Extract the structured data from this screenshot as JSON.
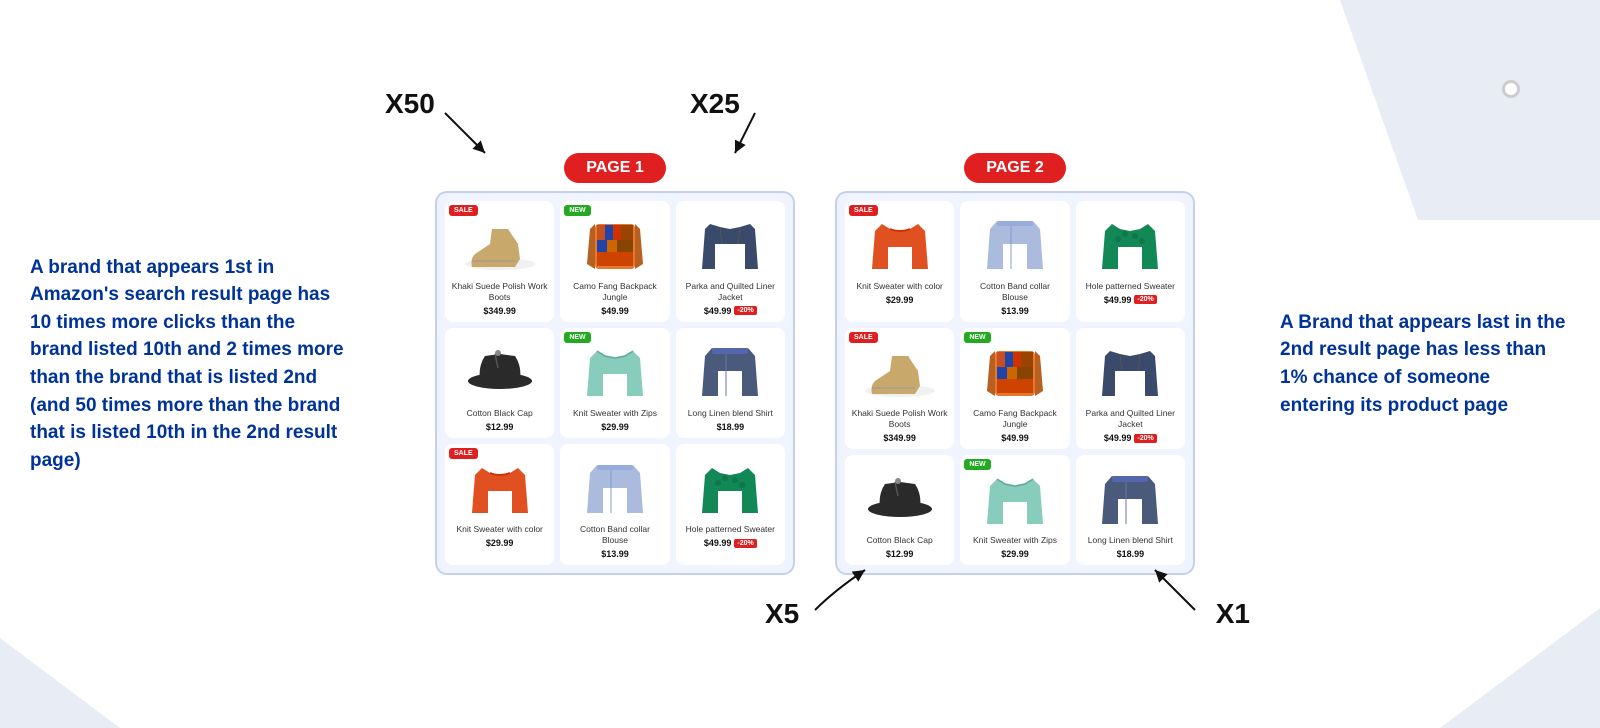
{
  "background": {
    "colors": {
      "accent_blue": "#003399",
      "sale_red": "#e02020",
      "new_green": "#22aa22",
      "page_bg": "#f0f4ff",
      "page_border": "#c5d0f0"
    }
  },
  "left_text": "A brand that appears 1st in Amazon's search result page has 10 times more clicks than the brand listed 10th and 2 times more than the brand that is listed 2nd (and 50 times more than the brand that is listed 10th in the 2nd result page)",
  "right_text": "A Brand that appears last in the 2nd result page has less than 1% chance of someone entering its product page",
  "multipliers": {
    "x50": "X50",
    "x25": "X25",
    "x5": "X5",
    "x1": "X1"
  },
  "pages": [
    {
      "id": "page1",
      "label": "PAGE 1",
      "products": [
        {
          "name": "Khaki Suede Polish Work Boots",
          "price": "$349.99",
          "badge": "SALE",
          "badge_type": "sale",
          "color": "#c8a86b",
          "type": "boot"
        },
        {
          "name": "Camo Fang Backpack Jungle",
          "price": "$49.99",
          "badge": "NEW",
          "badge_type": "new",
          "color": "#e67830",
          "type": "jacket_camo"
        },
        {
          "name": "Parka and Quilted Liner Jacket",
          "price": "$49.99",
          "badge": "",
          "badge_type": "",
          "discount": "-20%",
          "color": "#3a4a6b",
          "type": "parka"
        },
        {
          "name": "Cotton Black Cap",
          "price": "$12.99",
          "badge": "",
          "badge_type": "",
          "color": "#2a2a2a",
          "type": "hat"
        },
        {
          "name": "Knit Sweater with Zips",
          "price": "$29.99",
          "badge": "NEW",
          "badge_type": "new",
          "color": "#88ccbb",
          "type": "knit"
        },
        {
          "name": "Long Linen blend Shirt",
          "price": "$18.99",
          "badge": "",
          "badge_type": "",
          "color": "#4a5a7a",
          "type": "linen"
        },
        {
          "name": "Knit Sweater with color",
          "price": "$29.99",
          "badge": "SALE",
          "badge_type": "sale",
          "color": "#e05020",
          "type": "sweater_orange"
        },
        {
          "name": "Cotton Band collar Blouse",
          "price": "$13.99",
          "badge": "",
          "badge_type": "",
          "color": "#aabbdd",
          "type": "blouse"
        },
        {
          "name": "Hole patterned Sweater",
          "price": "$49.99",
          "badge": "",
          "badge_type": "",
          "discount": "-20%",
          "color": "#118855",
          "type": "sweater_green"
        }
      ]
    },
    {
      "id": "page2",
      "label": "PAGE 2",
      "products": [
        {
          "name": "Knit Sweater with color",
          "price": "$29.99",
          "badge": "SALE",
          "badge_type": "sale",
          "color": "#e05020",
          "type": "sweater_orange"
        },
        {
          "name": "Cotton Band collar Blouse",
          "price": "$13.99",
          "badge": "",
          "badge_type": "",
          "color": "#aabbdd",
          "type": "blouse"
        },
        {
          "name": "Hole patterned Sweater",
          "price": "$49.99",
          "badge": "",
          "badge_type": "",
          "discount": "-20%",
          "color": "#118855",
          "type": "sweater_green"
        },
        {
          "name": "Khaki Suede Polish Work Boots",
          "price": "$349.99",
          "badge": "SALE",
          "badge_type": "sale",
          "color": "#c8a86b",
          "type": "boot"
        },
        {
          "name": "Camo Fang Backpack Jungle",
          "price": "$49.99",
          "badge": "NEW",
          "badge_type": "new",
          "color": "#e67830",
          "type": "jacket_camo"
        },
        {
          "name": "Parka and Quilted Liner Jacket",
          "price": "$49.99",
          "badge": "",
          "badge_type": "",
          "discount": "-20%",
          "color": "#3a4a6b",
          "type": "parka"
        },
        {
          "name": "Cotton Black Cap",
          "price": "$12.99",
          "badge": "",
          "badge_type": "",
          "color": "#2a2a2a",
          "type": "hat"
        },
        {
          "name": "Knit Sweater with Zips",
          "price": "$29.99",
          "badge": "NEW",
          "badge_type": "new",
          "color": "#88ccbb",
          "type": "knit"
        },
        {
          "name": "Long Linen blend Shirt",
          "price": "$18.99",
          "badge": "",
          "badge_type": "",
          "color": "#4a5a7a",
          "type": "linen"
        }
      ]
    }
  ]
}
